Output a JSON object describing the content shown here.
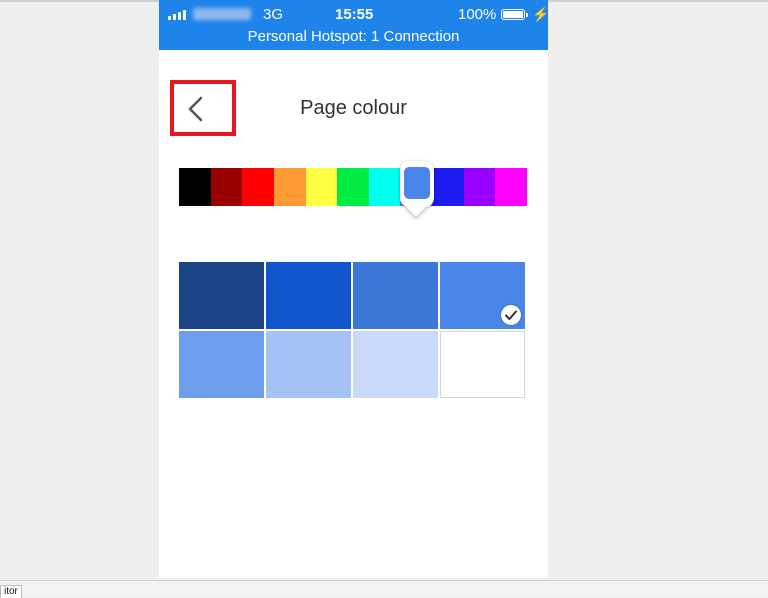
{
  "status_bar": {
    "network": "3G",
    "time": "15:55",
    "battery": "100%",
    "charging_symbol": "⚡",
    "hotspot": "Personal Hotspot: 1 Connection"
  },
  "header": {
    "title": "Page colour",
    "back_icon": "chevron-left-icon"
  },
  "hue_palette": {
    "colors": [
      "#000000",
      "#990000",
      "#ff0000",
      "#ff9933",
      "#ffff44",
      "#00ee44",
      "#00ffee",
      "#4a86e8",
      "#1c1cf0",
      "#9900ff",
      "#ff00ff"
    ],
    "selected_index": 7
  },
  "shade_grid": {
    "colors": [
      "#1c4587",
      "#1155cc",
      "#3c78d8",
      "#4a86e8",
      "#6d9eeb",
      "#a4c2f4",
      "#c9daf8",
      "#ffffff"
    ],
    "selected_index": 3,
    "selected_icon": "check-icon"
  },
  "bottom_bar": {
    "label": "itor"
  }
}
